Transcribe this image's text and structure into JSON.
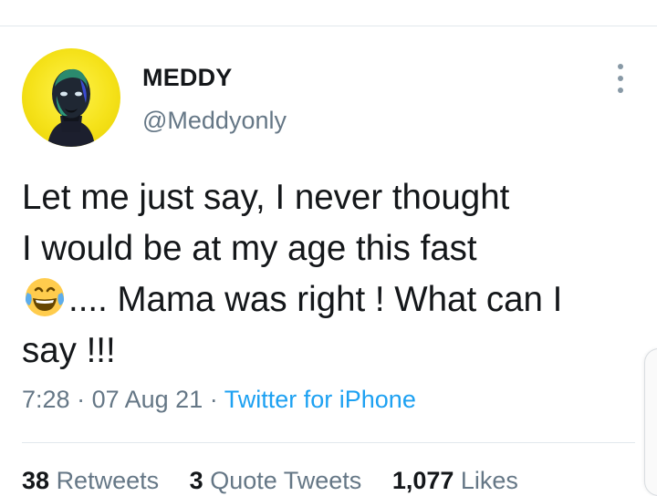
{
  "tweet": {
    "author": {
      "display_name": "MEDDY",
      "handle": "@Meddyonly"
    },
    "text_lines": [
      "Let me just say, I never thought",
      "I would be at my age this fast",
      ".... Mama was right ! What can I",
      "say !!!"
    ],
    "emoji": "face-with-tears-of-joy",
    "time": "7:28",
    "separator": "·",
    "date": "07 Aug 21",
    "source": "Twitter for iPhone",
    "stats": {
      "retweets_count": "38",
      "retweets_label": "Retweets",
      "quotes_count": "3",
      "quotes_label": "Quote Tweets",
      "likes_count": "1,077",
      "likes_label": "Likes"
    }
  },
  "colors": {
    "text": "#14171a",
    "secondary": "#657786",
    "link": "#1da1f2",
    "avatar_bg": "#f5e21a",
    "divider": "#e1e8ed"
  }
}
